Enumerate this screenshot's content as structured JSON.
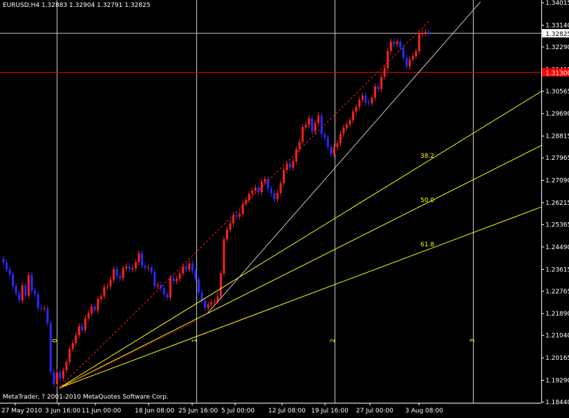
{
  "chart_data": {
    "type": "candlestick",
    "symbol_line": "EURUSD,H4  1.32883 1.32904 1.32791 1.32825",
    "current_price": "1.32825",
    "level_price": "1.31300",
    "price_ticks": [
      "1.34015",
      "1.33140",
      "1.32290",
      "1.31415",
      "1.30565",
      "1.29690",
      "1.28815",
      "1.27965",
      "1.27090",
      "1.26215",
      "1.25365",
      "1.24490",
      "1.23615",
      "1.22765",
      "1.21890",
      "1.21040",
      "1.20165",
      "1.19290",
      "1.18440"
    ],
    "time_ticks": [
      "27 May 2010",
      "3 Jun 16:00",
      "11 Jun 00:00",
      "18 Jun 08:00",
      "25 Jun 16:00",
      "5 Jul 00:00",
      "12 Jul 08:00",
      "19 Jul 16:00",
      "27 Jul 00:00",
      "3 Aug 08:00"
    ],
    "fib_levels": [
      "38.2",
      "50.0",
      "61.8"
    ],
    "time_zones": [
      "0",
      "1",
      "2",
      "3"
    ],
    "colors": {
      "bull": "#ff2020",
      "bear": "#2a2aff",
      "grid": "#c8c8c8",
      "fib": "#ffff00",
      "level": "#ff0000",
      "channel": "#c8c8c8",
      "dotted": "#ff2020"
    },
    "price_series_close": [
      1.2388,
      1.2362,
      1.2342,
      1.2296,
      1.2268,
      1.2241,
      1.2299,
      1.2259,
      1.2339,
      1.2279,
      1.2265,
      1.2211,
      1.2208,
      1.2209,
      1.2151,
      1.1962,
      1.1914,
      1.196,
      1.1937,
      1.1968,
      1.2,
      1.2051,
      1.2074,
      1.2105,
      1.214,
      1.2125,
      1.2171,
      1.2191,
      1.2216,
      1.2202,
      1.2246,
      1.2256,
      1.2293,
      1.2296,
      1.2322,
      1.2362,
      1.2336,
      1.2327,
      1.2366,
      1.2373,
      1.2362,
      1.2366,
      1.239,
      1.2424,
      1.2377,
      1.2367,
      1.2369,
      1.2351,
      1.2296,
      1.23,
      1.2288,
      1.2265,
      1.2252,
      1.2329,
      1.2316,
      1.2325,
      1.2346,
      1.2374,
      1.2361,
      1.2385,
      1.2356,
      1.2323,
      1.2272,
      1.224,
      1.2211,
      1.2224,
      1.2233,
      1.2237,
      1.2256,
      1.2346,
      1.2479,
      1.2517,
      1.2541,
      1.2573,
      1.2568,
      1.2578,
      1.2618,
      1.2632,
      1.2656,
      1.2669,
      1.268,
      1.2663,
      1.2703,
      1.2714,
      1.2677,
      1.2658,
      1.2635,
      1.266,
      1.2698,
      1.2749,
      1.2773,
      1.2758,
      1.2783,
      1.283,
      1.286,
      1.2917,
      1.2925,
      1.2951,
      1.2899,
      1.2933,
      1.2962,
      1.2889,
      1.2876,
      1.2839,
      1.2811,
      1.2839,
      1.2853,
      1.2891,
      1.2914,
      1.2927,
      1.2943,
      1.2977,
      1.2994,
      1.3023,
      1.304,
      1.3012,
      1.3009,
      1.3031,
      1.3075,
      1.3064,
      1.3113,
      1.3147,
      1.3214,
      1.325,
      1.3241,
      1.325,
      1.3227,
      1.3187,
      1.3152,
      1.318,
      1.3193,
      1.3212,
      1.3279,
      1.3283,
      1.3287,
      1.3282
    ]
  },
  "footer": {
    "copyright": "MetaTrader, ? 2001-2010 MetaQuotes Software Corp."
  }
}
